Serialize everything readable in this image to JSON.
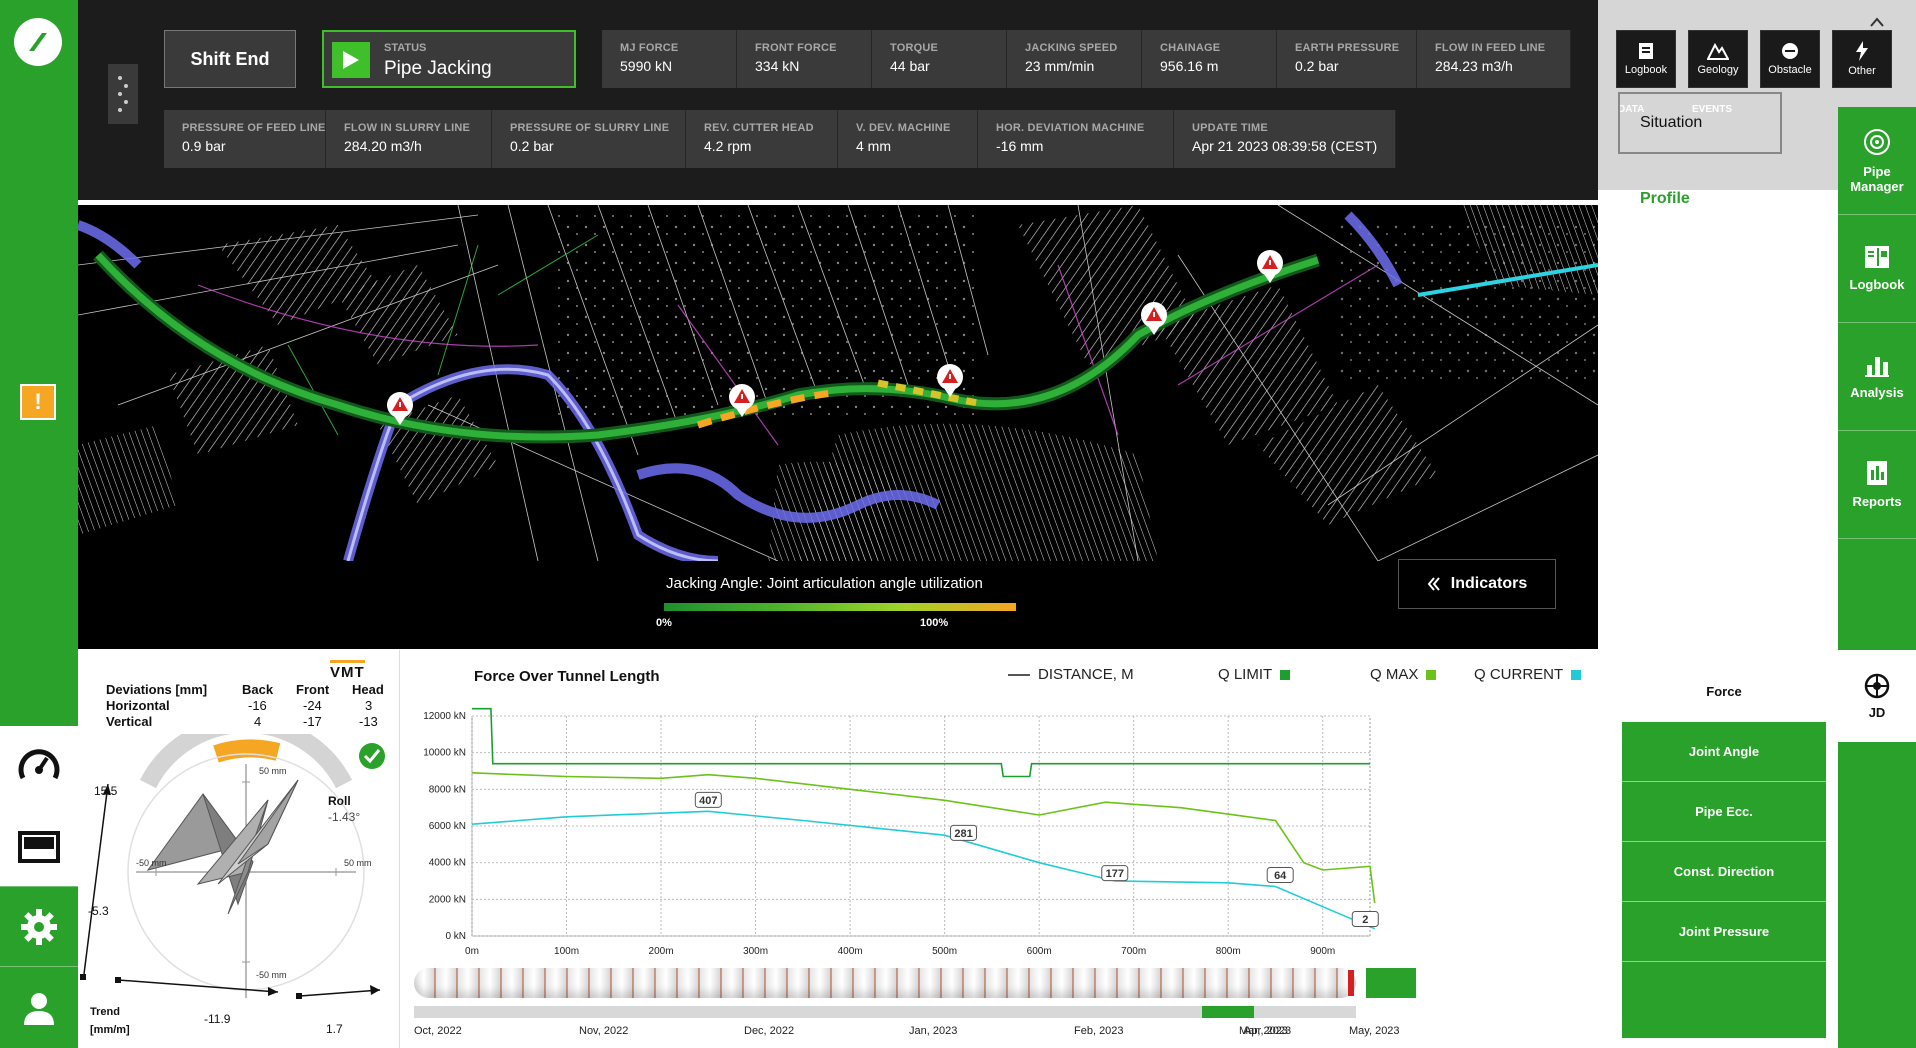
{
  "header": {
    "shift_button": "Shift End",
    "status_label": "STATUS",
    "status_value": "Pipe Jacking",
    "metrics_row1": [
      {
        "label": "MJ FORCE",
        "value": "5990 kN"
      },
      {
        "label": "FRONT FORCE",
        "value": "334 kN"
      },
      {
        "label": "TORQUE",
        "value": "44 bar"
      },
      {
        "label": "JACKING SPEED",
        "value": "23 mm/min"
      },
      {
        "label": "CHAINAGE",
        "value": "956.16 m"
      },
      {
        "label": "EARTH PRESSURE",
        "value": "0.2 bar"
      },
      {
        "label": "FLOW IN FEED LINE",
        "value": "284.23 m3/h"
      }
    ],
    "metrics_row2": [
      {
        "label": "PRESSURE OF FEED LINE",
        "value": "0.9 bar"
      },
      {
        "label": "FLOW IN SLURRY LINE",
        "value": "284.20 m3/h"
      },
      {
        "label": "PRESSURE OF SLURRY LINE",
        "value": "0.2 bar"
      },
      {
        "label": "REV. CUTTER HEAD",
        "value": "4.2 rpm"
      },
      {
        "label": "V. DEV. MACHINE",
        "value": "4 mm"
      },
      {
        "label": "HOR. DEVIATION MACHINE",
        "value": "-16 mm"
      },
      {
        "label": "UPDATE TIME",
        "value": "Apr 21 2023 08:39:58 (CEST)"
      }
    ]
  },
  "top_right": {
    "buttons": [
      {
        "label": "Logbook",
        "icon": "logbook-icon"
      },
      {
        "label": "Geology",
        "icon": "geology-icon"
      },
      {
        "label": "Obstacle",
        "icon": "obstacle-icon"
      },
      {
        "label": "Other",
        "icon": "lightning-icon"
      }
    ],
    "data_label": "DATA",
    "events_label": "EVENTS",
    "situation": "Situation",
    "profile": "Profile"
  },
  "right_tabs": [
    {
      "label": "Pipe Manager",
      "icon": "target-icon"
    },
    {
      "label": "Logbook",
      "icon": "book-icon"
    },
    {
      "label": "Analysis",
      "icon": "bar-chart-icon"
    },
    {
      "label": "Reports",
      "icon": "report-icon"
    }
  ],
  "map": {
    "legend_title": "Jacking Angle: Joint articulation angle utilization",
    "legend_min": "0%",
    "legend_max": "100%",
    "indicators_button": "Indicators",
    "colors": {
      "low": "#1e8f2e",
      "mid": "#7cd02a",
      "high": "#f5a623"
    }
  },
  "deviations": {
    "vmt_logo": "VMT",
    "title": "Deviations [mm]",
    "cols": [
      "Back",
      "Front",
      "Head"
    ],
    "horizontal_label": "Horizontal",
    "horizontal": [
      "-16",
      "-24",
      "3"
    ],
    "vertical_label": "Vertical",
    "vertical": [
      "4",
      "-17",
      "-13"
    ],
    "roll_label": "Roll",
    "roll_value": "-1.43°",
    "scale_top": "50 mm",
    "scale_bottom": "-50 mm",
    "scale_left": "-50 mm",
    "scale_right": "50 mm",
    "trend_label": "Trend",
    "trend_unit": "[mm/m]",
    "trend_vals": [
      "15.5",
      "-5.3",
      "-11.9",
      "1.7"
    ]
  },
  "chart_panel": {
    "title": "Force Over Tunnel Length",
    "legend": [
      {
        "label": "DISTANCE, M",
        "color": "#555555"
      },
      {
        "label": "Q LIMIT",
        "color": "#1e9e2e"
      },
      {
        "label": "Q MAX",
        "color": "#6cc21a"
      },
      {
        "label": "Q CURRENT",
        "color": "#22ccd6"
      }
    ],
    "timeline_dates": [
      "Oct, 2022",
      "Nov, 2022",
      "Dec, 2022",
      "Jan, 2023",
      "Feb, 2023",
      "Mar, 2023",
      "Apr, 2023",
      "May, 2023"
    ]
  },
  "chart_data": {
    "type": "line",
    "title": "Force Over Tunnel Length",
    "xlabel": "",
    "ylabel": "",
    "xlim": [
      0,
      950
    ],
    "ylim": [
      0,
      12000
    ],
    "x_ticks": [
      "0m",
      "100m",
      "200m",
      "300m",
      "400m",
      "500m",
      "600m",
      "700m",
      "800m",
      "900m"
    ],
    "y_ticks": [
      "0 kN",
      "2000 kN",
      "4000 kN",
      "6000 kN",
      "8000 kN",
      "10000 kN",
      "12000 kN"
    ],
    "series": [
      {
        "name": "Q LIMIT",
        "color": "#1e9e2e",
        "x": [
          0,
          20,
          22,
          560,
          562,
          590,
          592,
          950
        ],
        "y": [
          12400,
          12400,
          9400,
          9400,
          8700,
          8700,
          9400,
          9400
        ]
      },
      {
        "name": "Q MAX",
        "color": "#6cc21a",
        "x": [
          0,
          50,
          100,
          200,
          250,
          300,
          400,
          500,
          600,
          670,
          750,
          850,
          880,
          900,
          950,
          955
        ],
        "y": [
          8900,
          8800,
          8700,
          8600,
          8800,
          8600,
          8000,
          7400,
          6600,
          7300,
          7000,
          6300,
          4000,
          3600,
          3800,
          1800
        ]
      },
      {
        "name": "Q CURRENT",
        "color": "#22ccd6",
        "x": [
          0,
          100,
          250,
          350,
          500,
          600,
          680,
          800,
          850,
          900,
          955
        ],
        "y": [
          6100,
          6500,
          6800,
          6300,
          5500,
          4000,
          3000,
          2900,
          2700,
          1600,
          400
        ]
      }
    ],
    "annotations": [
      {
        "label": "407",
        "x": 250,
        "y": 7400
      },
      {
        "label": "281",
        "x": 520,
        "y": 5600
      },
      {
        "label": "177",
        "x": 680,
        "y": 3400
      },
      {
        "label": "64",
        "x": 855,
        "y": 3300
      },
      {
        "label": "2",
        "x": 945,
        "y": 900
      }
    ]
  },
  "force_menu": {
    "header": "Force",
    "items": [
      "Joint Angle",
      "Pipe Ecc.",
      "Const. Direction",
      "Joint Pressure"
    ],
    "jd_label": "JD"
  }
}
